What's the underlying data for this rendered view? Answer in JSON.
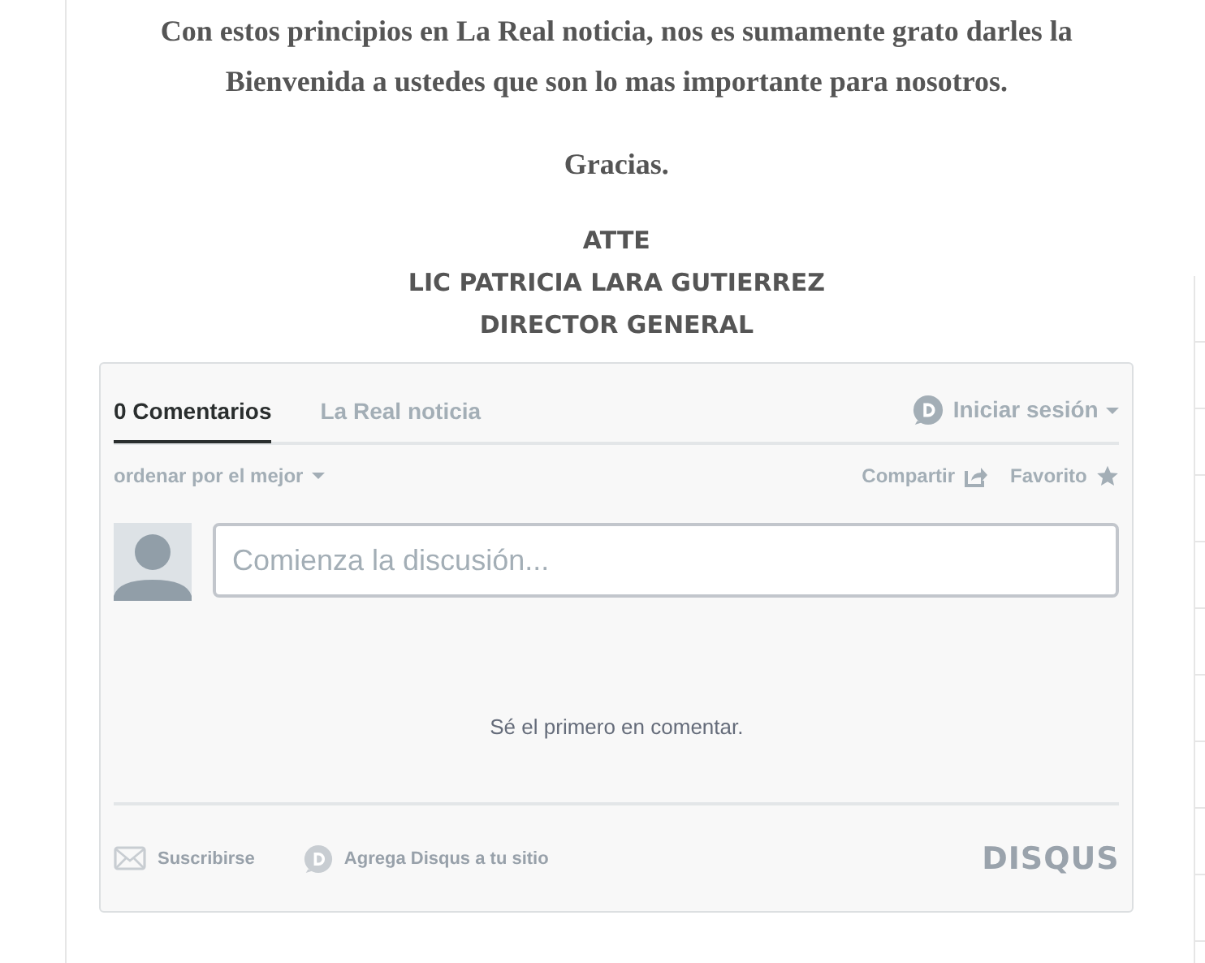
{
  "article": {
    "paragraphs": [
      "Con estos principios en La Real noticia, nos es sumamente grato darles la Bienvenida a ustedes que son lo mas importante para nosotros.",
      "Gracias."
    ],
    "signature": [
      "ATTE",
      "LIC PATRICIA LARA GUTIERREZ",
      "DIRECTOR GENERAL"
    ]
  },
  "comments": {
    "tabs": [
      {
        "label": "0 Comentarios",
        "selected": true
      },
      {
        "label": "La Real noticia",
        "selected": false
      }
    ],
    "login": "Iniciar sesión",
    "sort": "ordenar por el mejor",
    "share": "Compartir",
    "favorite": "Favorito",
    "input": {
      "placeholder": "Comienza la discusión..."
    },
    "empty_message": "Sé el primero en comentar.",
    "footer": {
      "subscribe": "Suscribirse",
      "add": "Agrega Disqus a tu sitio",
      "logo": "DISQUS"
    }
  }
}
